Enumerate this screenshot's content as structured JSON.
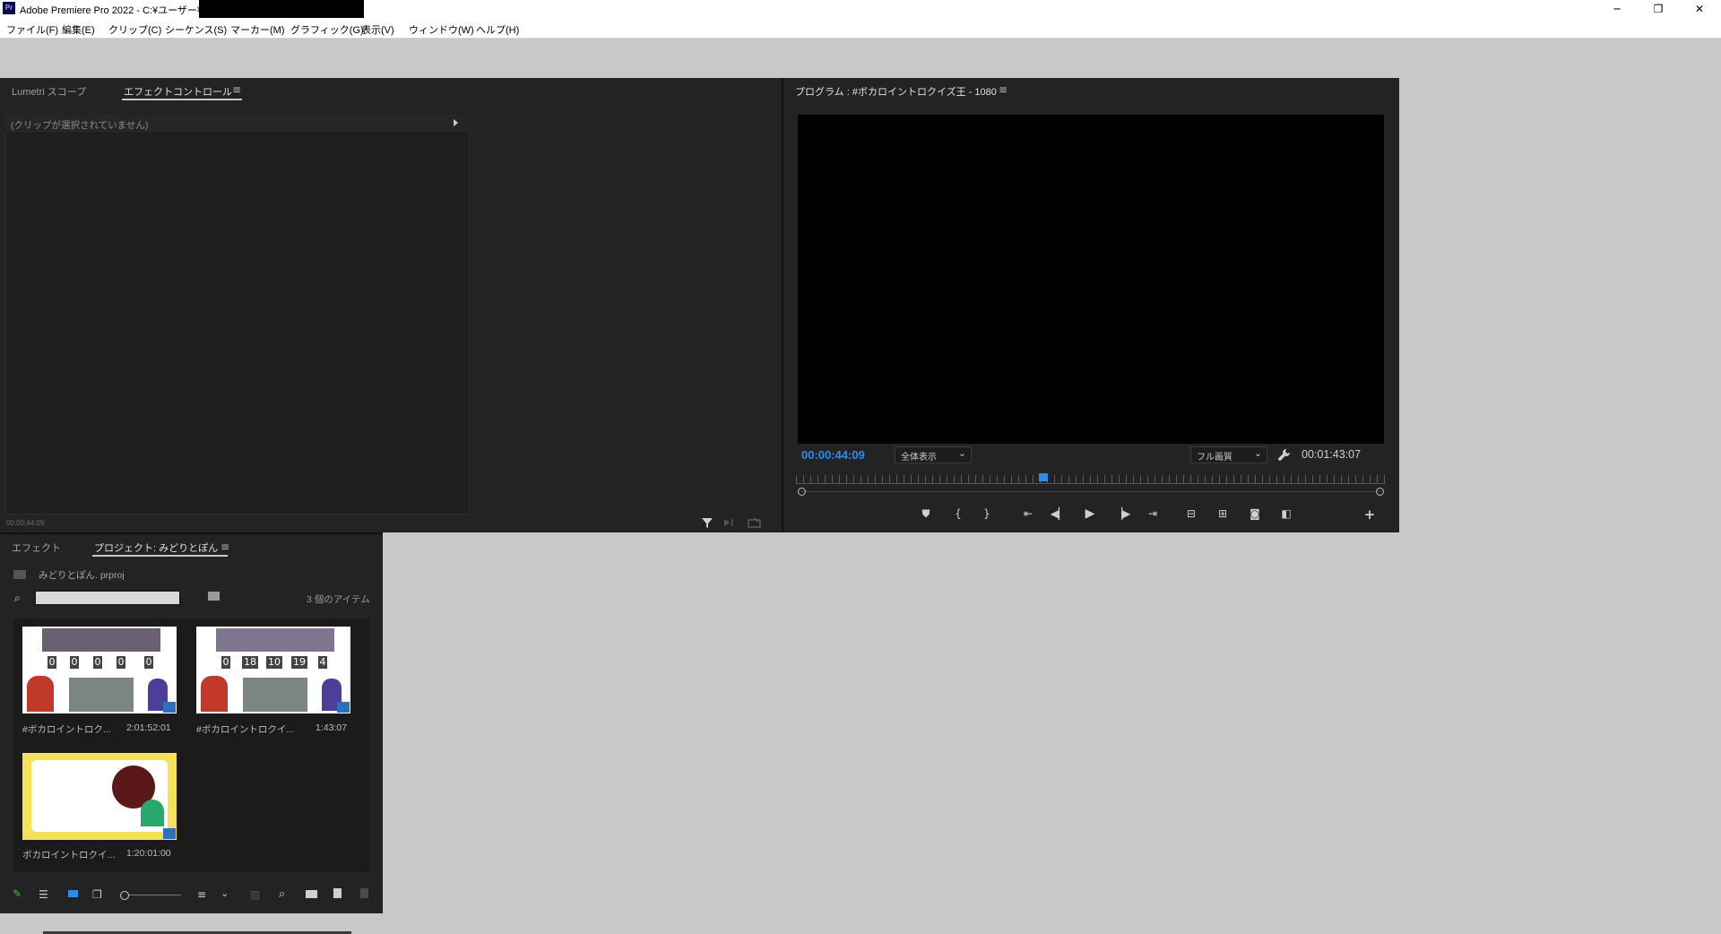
{
  "window": {
    "title": "Adobe Premiere Pro 2022 - C:¥ユーザー¥",
    "app_icon_label": "Pr",
    "minimize": "─",
    "restore": "❐",
    "close": "✕"
  },
  "menu": {
    "items": [
      "ファイル(F)",
      "編集(E)",
      "クリップ(C)",
      "シーケンス(S)",
      "マーカー(M)",
      "グラフィック(G)",
      "表示(V)",
      "ウィンドウ(W)",
      "ヘルプ(H)"
    ]
  },
  "effect_panel": {
    "tabs": [
      "Lumetri スコープ",
      "エフェクトコントロール"
    ],
    "active_tab": 1,
    "empty_message": "(クリップが選択されていません)",
    "timecode": "00:00:44:09"
  },
  "program_monitor": {
    "title": "プログラム : #ボカロイントロクイズ王 - 1080",
    "current_time": "00:00:44:09",
    "zoom": "全体表示",
    "quality": "フル画質",
    "duration": "00:01:43:07",
    "playhead_fraction": 0.42,
    "accent_color": "#2d8ceb"
  },
  "project_panel": {
    "tabs": [
      "エフェクト",
      "プロジェクト: みどりとぽん"
    ],
    "active_tab": 1,
    "project_file": "みどりとぽん. prproj",
    "item_count": "3 個のアイテム",
    "items": [
      {
        "name": "#ボカロイントロク...",
        "duration": "2:01:52:01",
        "counters": [
          "0",
          "0",
          "0",
          "0",
          "0"
        ]
      },
      {
        "name": "#ボカロイントロクイ...",
        "duration": "1:43:07",
        "counters": [
          "0",
          "18",
          "10",
          "19",
          "4"
        ]
      },
      {
        "name": "ボカロイントロクイ...",
        "duration": "1:20:01:00"
      }
    ]
  },
  "icons": {
    "filter": "filter-icon",
    "search": "search-icon",
    "wrench": "wrench-icon"
  }
}
